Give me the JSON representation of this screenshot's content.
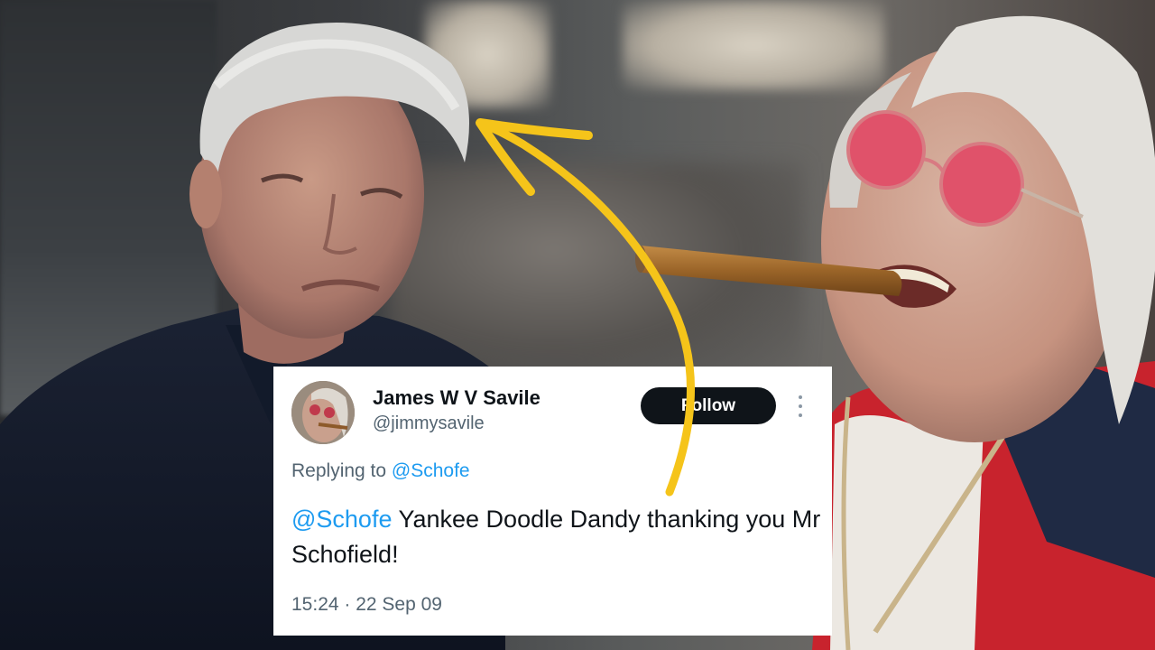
{
  "tweet": {
    "display_name": "James W V Savile",
    "handle": "@jimmysavile",
    "follow_label": "Follow",
    "replying_prefix": "Replying to",
    "replying_to": "@Schofe",
    "mention": "@Schofe",
    "text": "Yankee Doodle Dandy thanking you Mr Schofield!",
    "timestamp": "15:24 · 22 Sep 09"
  },
  "icons": {
    "more": "more-options-icon",
    "arrow": "curved-arrow-icon"
  },
  "colors": {
    "arrow": "#f5c41a",
    "link": "#1d9bf0",
    "button": "#0f1419"
  }
}
